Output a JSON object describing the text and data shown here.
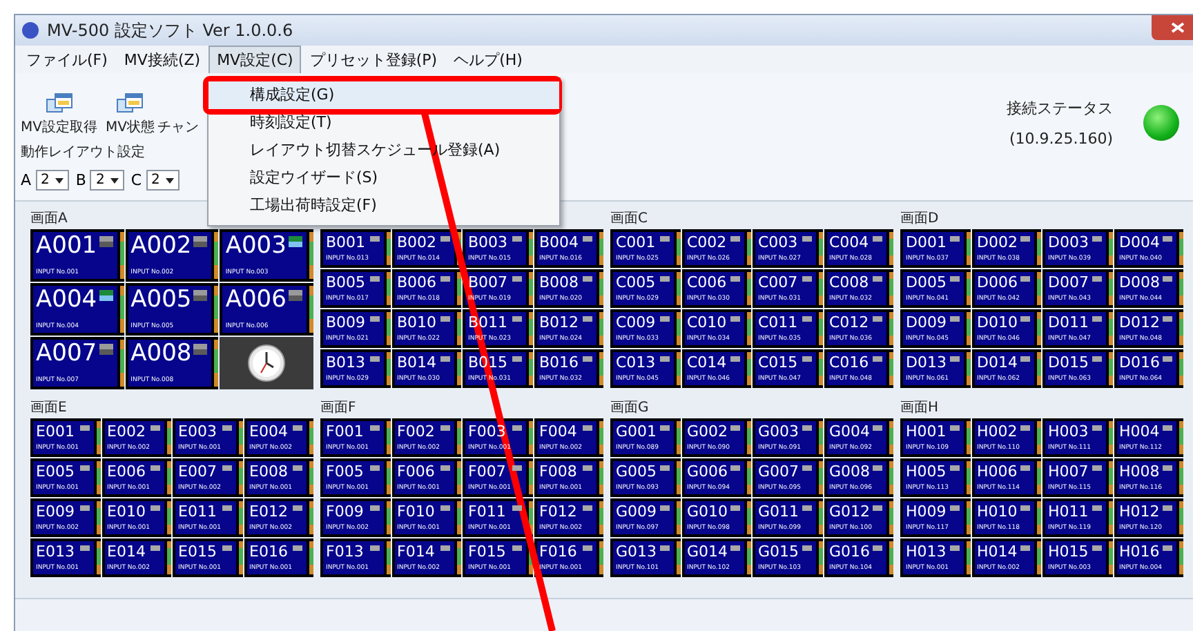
{
  "window": {
    "title": "MV-500 設定ソフト Ver 1.0.0.6"
  },
  "menu_bar": [
    {
      "label": "ファイル(F)",
      "selected": false
    },
    {
      "label": "MV接続(Z)",
      "selected": false
    },
    {
      "label": "MV設定(C)",
      "selected": true
    },
    {
      "label": "プリセット登録(P)",
      "selected": false
    },
    {
      "label": "ヘルプ(H)",
      "selected": false
    }
  ],
  "dropdown": [
    {
      "label": "構成設定(G)",
      "selected": true
    },
    {
      "label": "時刻設定(T)",
      "selected": false
    },
    {
      "label": "レイアウト切替スケジュール登録(A)",
      "selected": false
    },
    {
      "label": "設定ウイザード(S)",
      "selected": false
    },
    {
      "label": "工場出荷時設定(F)",
      "selected": false
    }
  ],
  "toolbar": {
    "buttons": [
      {
        "label": "MV設定取得"
      },
      {
        "label": "MV状態"
      }
    ],
    "cut_label": "チャン"
  },
  "layout_settings": {
    "title": "動作レイアウト設定",
    "selects": [
      {
        "label": "A",
        "value": "2"
      },
      {
        "label": "B",
        "value": "2"
      },
      {
        "label": "C",
        "value": "2"
      }
    ]
  },
  "status": {
    "label": "接続ステータス",
    "address": "(10.9.25.160)",
    "connected": true
  },
  "screens": [
    {
      "label": "画面A",
      "tiles": [
        {
          "kind": "input",
          "name": "A001",
          "input": "INPUT No.001",
          "active": false
        },
        {
          "kind": "input",
          "name": "A002",
          "input": "INPUT No.002",
          "active": false
        },
        {
          "kind": "input",
          "name": "A003",
          "input": "INPUT No.003",
          "active": true
        },
        {
          "kind": "input",
          "name": "A004",
          "input": "INPUT No.004",
          "active": true
        },
        {
          "kind": "input",
          "name": "A005",
          "input": "INPUT No.005",
          "active": false
        },
        {
          "kind": "input",
          "name": "A006",
          "input": "INPUT No.006",
          "active": false
        },
        {
          "kind": "input",
          "name": "A007",
          "input": "INPUT No.007",
          "active": false
        },
        {
          "kind": "input",
          "name": "A008",
          "input": "INPUT No.008",
          "active": false
        },
        {
          "kind": "clock"
        }
      ]
    },
    {
      "tiles": [
        {
          "name": "B001",
          "input": "INPUT No.013"
        },
        {
          "name": "B002",
          "input": "INPUT No.014"
        },
        {
          "name": "B003",
          "input": "INPUT No.015"
        },
        {
          "name": "B004",
          "input": "INPUT No.016"
        },
        {
          "name": "B005",
          "input": "INPUT No.017"
        },
        {
          "name": "B006",
          "input": "INPUT No.018"
        },
        {
          "name": "B007",
          "input": "INPUT No.019"
        },
        {
          "name": "B008",
          "input": "INPUT No.020"
        },
        {
          "name": "B009",
          "input": "INPUT No.021"
        },
        {
          "name": "B010",
          "input": "INPUT No.022"
        },
        {
          "name": "B011",
          "input": "INPUT No.023"
        },
        {
          "name": "B012",
          "input": "INPUT No.024"
        },
        {
          "name": "B013",
          "input": "INPUT No.029"
        },
        {
          "name": "B014",
          "input": "INPUT No.030"
        },
        {
          "name": "B015",
          "input": "INPUT No.031"
        },
        {
          "name": "B016",
          "input": "INPUT No.032"
        }
      ]
    },
    {
      "label": "画面C",
      "tiles": [
        {
          "name": "C001",
          "input": "INPUT No.025"
        },
        {
          "name": "C002",
          "input": "INPUT No.026"
        },
        {
          "name": "C003",
          "input": "INPUT No.027"
        },
        {
          "name": "C004",
          "input": "INPUT No.028"
        },
        {
          "name": "C005",
          "input": "INPUT No.029"
        },
        {
          "name": "C006",
          "input": "INPUT No.030"
        },
        {
          "name": "C007",
          "input": "INPUT No.031"
        },
        {
          "name": "C008",
          "input": "INPUT No.032"
        },
        {
          "name": "C009",
          "input": "INPUT No.033"
        },
        {
          "name": "C010",
          "input": "INPUT No.034"
        },
        {
          "name": "C011",
          "input": "INPUT No.035"
        },
        {
          "name": "C012",
          "input": "INPUT No.036"
        },
        {
          "name": "C013",
          "input": "INPUT No.045"
        },
        {
          "name": "C014",
          "input": "INPUT No.046"
        },
        {
          "name": "C015",
          "input": "INPUT No.047"
        },
        {
          "name": "C016",
          "input": "INPUT No.048"
        }
      ]
    },
    {
      "label": "画面D",
      "tiles": [
        {
          "name": "D001",
          "input": "INPUT No.037"
        },
        {
          "name": "D002",
          "input": "INPUT No.038"
        },
        {
          "name": "D003",
          "input": "INPUT No.039"
        },
        {
          "name": "D004",
          "input": "INPUT No.040"
        },
        {
          "name": "D005",
          "input": "INPUT No.041"
        },
        {
          "name": "D006",
          "input": "INPUT No.042"
        },
        {
          "name": "D007",
          "input": "INPUT No.043"
        },
        {
          "name": "D008",
          "input": "INPUT No.044"
        },
        {
          "name": "D009",
          "input": "INPUT No.045"
        },
        {
          "name": "D010",
          "input": "INPUT No.046"
        },
        {
          "name": "D011",
          "input": "INPUT No.047"
        },
        {
          "name": "D012",
          "input": "INPUT No.048"
        },
        {
          "name": "D013",
          "input": "INPUT No.061"
        },
        {
          "name": "D014",
          "input": "INPUT No.062"
        },
        {
          "name": "D015",
          "input": "INPUT No.063"
        },
        {
          "name": "D016",
          "input": "INPUT No.064"
        }
      ]
    },
    {
      "label": "画面E",
      "tiles": [
        {
          "name": "E001",
          "input": "INPUT No.001"
        },
        {
          "name": "E002",
          "input": "INPUT No.002"
        },
        {
          "name": "E003",
          "input": "INPUT No.001"
        },
        {
          "name": "E004",
          "input": "INPUT No.002"
        },
        {
          "name": "E005",
          "input": "INPUT No.001"
        },
        {
          "name": "E006",
          "input": "INPUT No.001"
        },
        {
          "name": "E007",
          "input": "INPUT No.002"
        },
        {
          "name": "E008",
          "input": "INPUT No.001"
        },
        {
          "name": "E009",
          "input": "INPUT No.002"
        },
        {
          "name": "E010",
          "input": "INPUT No.001"
        },
        {
          "name": "E011",
          "input": "INPUT No.001"
        },
        {
          "name": "E012",
          "input": "INPUT No.002"
        },
        {
          "name": "E013",
          "input": "INPUT No.001"
        },
        {
          "name": "E014",
          "input": "INPUT No.002"
        },
        {
          "name": "E015",
          "input": "INPUT No.001"
        },
        {
          "name": "E016",
          "input": "INPUT No.001"
        }
      ]
    },
    {
      "label": "画面F",
      "tiles": [
        {
          "name": "F001",
          "input": "INPUT No.001"
        },
        {
          "name": "F002",
          "input": "INPUT No.002"
        },
        {
          "name": "F003",
          "input": "INPUT No.001"
        },
        {
          "name": "F004",
          "input": "INPUT No.002"
        },
        {
          "name": "F005",
          "input": "INPUT No.001"
        },
        {
          "name": "F006",
          "input": "INPUT No.001"
        },
        {
          "name": "F007",
          "input": "INPUT No.001"
        },
        {
          "name": "F008",
          "input": "INPUT No.001"
        },
        {
          "name": "F009",
          "input": "INPUT No.002"
        },
        {
          "name": "F010",
          "input": "INPUT No.001"
        },
        {
          "name": "F011",
          "input": "INPUT No.001"
        },
        {
          "name": "F012",
          "input": "INPUT No.002"
        },
        {
          "name": "F013",
          "input": "INPUT No.001"
        },
        {
          "name": "F014",
          "input": "INPUT No.002"
        },
        {
          "name": "F015",
          "input": "INPUT No.001"
        },
        {
          "name": "F016",
          "input": "INPUT No.001"
        }
      ]
    },
    {
      "label": "画面G",
      "tiles": [
        {
          "name": "G001",
          "input": "INPUT No.089"
        },
        {
          "name": "G002",
          "input": "INPUT No.090"
        },
        {
          "name": "G003",
          "input": "INPUT No.091"
        },
        {
          "name": "G004",
          "input": "INPUT No.092"
        },
        {
          "name": "G005",
          "input": "INPUT No.093"
        },
        {
          "name": "G006",
          "input": "INPUT No.094"
        },
        {
          "name": "G007",
          "input": "INPUT No.095"
        },
        {
          "name": "G008",
          "input": "INPUT No.096"
        },
        {
          "name": "G009",
          "input": "INPUT No.097"
        },
        {
          "name": "G010",
          "input": "INPUT No.098"
        },
        {
          "name": "G011",
          "input": "INPUT No.099"
        },
        {
          "name": "G012",
          "input": "INPUT No.100"
        },
        {
          "name": "G013",
          "input": "INPUT No.101"
        },
        {
          "name": "G014",
          "input": "INPUT No.102"
        },
        {
          "name": "G015",
          "input": "INPUT No.103"
        },
        {
          "name": "G016",
          "input": "INPUT No.104"
        }
      ]
    },
    {
      "label": "画面H",
      "tiles": [
        {
          "name": "H001",
          "input": "INPUT No.109"
        },
        {
          "name": "H002",
          "input": "INPUT No.110"
        },
        {
          "name": "H003",
          "input": "INPUT No.111"
        },
        {
          "name": "H004",
          "input": "INPUT No.112"
        },
        {
          "name": "H005",
          "input": "INPUT No.113"
        },
        {
          "name": "H006",
          "input": "INPUT No.114"
        },
        {
          "name": "H007",
          "input": "INPUT No.115"
        },
        {
          "name": "H008",
          "input": "INPUT No.116"
        },
        {
          "name": "H009",
          "input": "INPUT No.117"
        },
        {
          "name": "H010",
          "input": "INPUT No.118"
        },
        {
          "name": "H011",
          "input": "INPUT No.119"
        },
        {
          "name": "H012",
          "input": "INPUT No.120"
        },
        {
          "name": "H013",
          "input": "INPUT No.001"
        },
        {
          "name": "H014",
          "input": "INPUT No.002"
        },
        {
          "name": "H015",
          "input": "INPUT No.003"
        },
        {
          "name": "H016",
          "input": "INPUT No.004"
        }
      ]
    }
  ]
}
